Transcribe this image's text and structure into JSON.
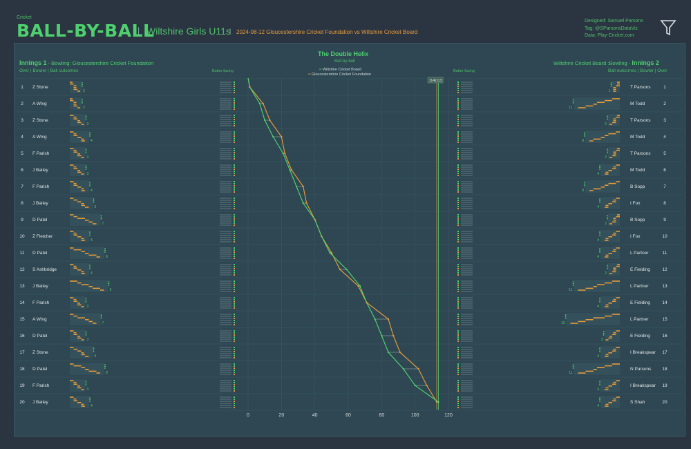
{
  "header": {
    "category": "Cricket",
    "title": "BALL-BY-BALL",
    "separator": "|",
    "team": "Wiltshire Girls U11s",
    "separator2": "|",
    "match": "2024-08-12 Gloucestershire Cricket Foundation vs Wiltshire Cricket Board",
    "credits": [
      "Designed: Samuel Parsons",
      "Tag: @SParsonsDataViz",
      "Data: Play-Cricket.com"
    ],
    "filter_icon": "filter-icon"
  },
  "colors": {
    "background": "#2b3542",
    "panel": "#2e4752",
    "green": "#4fd06f",
    "orange": "#e59a3a",
    "text": "#cfd8dc",
    "grid": "#3b5966"
  },
  "innings1": {
    "title_bold": "Innings 1",
    "title_rest": " - Bowling: Gloucestershire Cricket Foundation",
    "subheader": "Over | Bowler | Ball outcomes",
    "batter_facing": "Batter facing",
    "overs": [
      {
        "over": "1",
        "bowler": "Z Stone"
      },
      {
        "over": "2",
        "bowler": "A Wing"
      },
      {
        "over": "3",
        "bowler": "Z Stone"
      },
      {
        "over": "4",
        "bowler": "A Wing"
      },
      {
        "over": "5",
        "bowler": "F Parish"
      },
      {
        "over": "6",
        "bowler": "J Bailey"
      },
      {
        "over": "7",
        "bowler": "F Parish"
      },
      {
        "over": "8",
        "bowler": "J Bailey"
      },
      {
        "over": "9",
        "bowler": "D Patel"
      },
      {
        "over": "10",
        "bowler": "Z Fletcher"
      },
      {
        "over": "11",
        "bowler": "D Patel"
      },
      {
        "over": "12",
        "bowler": "S Ashbridge"
      },
      {
        "over": "13",
        "bowler": "J Bailey"
      },
      {
        "over": "14",
        "bowler": "F Parish"
      },
      {
        "over": "15",
        "bowler": "A Wing"
      },
      {
        "over": "16",
        "bowler": "D Patel"
      },
      {
        "over": "17",
        "bowler": "Z Stone"
      },
      {
        "over": "18",
        "bowler": "D Patel"
      },
      {
        "over": "19",
        "bowler": "F Parish"
      },
      {
        "over": "20",
        "bowler": "J Bailey"
      }
    ]
  },
  "innings2": {
    "title_rest": "Wiltshire Cricket Board :Bowling - ",
    "title_bold": "Innings 2",
    "subheader": "Ball outcomes | Bowler | Over",
    "batter_facing": "Batter facing",
    "overs": [
      {
        "over": "1",
        "bowler": "T Parsons"
      },
      {
        "over": "2",
        "bowler": "M Todd"
      },
      {
        "over": "3",
        "bowler": "T Parsons"
      },
      {
        "over": "4",
        "bowler": "M Todd"
      },
      {
        "over": "5",
        "bowler": "T Parsons"
      },
      {
        "over": "6",
        "bowler": "M Todd"
      },
      {
        "over": "7",
        "bowler": "B Sopp"
      },
      {
        "over": "8",
        "bowler": "I Fox"
      },
      {
        "over": "9",
        "bowler": "B Sopp"
      },
      {
        "over": "10",
        "bowler": "I Fox"
      },
      {
        "over": "11",
        "bowler": "L Partner"
      },
      {
        "over": "12",
        "bowler": "E Fielding"
      },
      {
        "over": "13",
        "bowler": "L Partner"
      },
      {
        "over": "14",
        "bowler": "E Fielding"
      },
      {
        "over": "15",
        "bowler": "L Partner"
      },
      {
        "over": "16",
        "bowler": "E Fielding"
      },
      {
        "over": "17",
        "bowler": "I Breakspear"
      },
      {
        "over": "18",
        "bowler": "N Parsons"
      },
      {
        "over": "19",
        "bowler": "I Breakspear"
      },
      {
        "over": "20",
        "bowler": "S Shah"
      }
    ]
  },
  "chart_data": {
    "type": "line",
    "title": "The Double Helix",
    "subtitle": "Ball-by-ball",
    "legend_position": "top-center",
    "series": [
      {
        "name": "Wiltshire Cricket Board",
        "color": "#4fd06f"
      },
      {
        "name": "Gloucestershire Cricket Foundation",
        "color": "#e59a3a"
      }
    ],
    "x_ticks": [
      "0",
      "20",
      "40",
      "60",
      "80",
      "100",
      "120"
    ],
    "xlim": [
      0,
      120
    ],
    "final_score_label": "114|113",
    "cumulative_runs_by_over": {
      "Wiltshire Cricket Board": [
        1,
        7,
        10,
        15,
        21,
        25,
        29,
        33,
        40,
        44,
        49,
        59,
        67,
        71,
        76,
        80,
        84,
        93,
        100,
        114
      ],
      "Gloucestershire Cricket Foundation": [
        1,
        9,
        13,
        20,
        22,
        26,
        33,
        35,
        40,
        44,
        50,
        55,
        66,
        71,
        84,
        87,
        91,
        102,
        107,
        113
      ]
    },
    "innings1_over_runs": [
      2,
      2,
      3,
      4,
      3,
      3,
      4,
      5,
      7,
      4,
      8,
      4,
      9,
      3,
      7,
      3,
      5,
      8,
      3,
      4
    ],
    "innings2_over_runs": [
      1,
      11,
      2,
      8,
      2,
      4,
      8,
      4,
      2,
      4,
      4,
      2,
      11,
      4,
      13,
      3,
      4,
      11,
      4,
      4
    ],
    "grid": true
  }
}
